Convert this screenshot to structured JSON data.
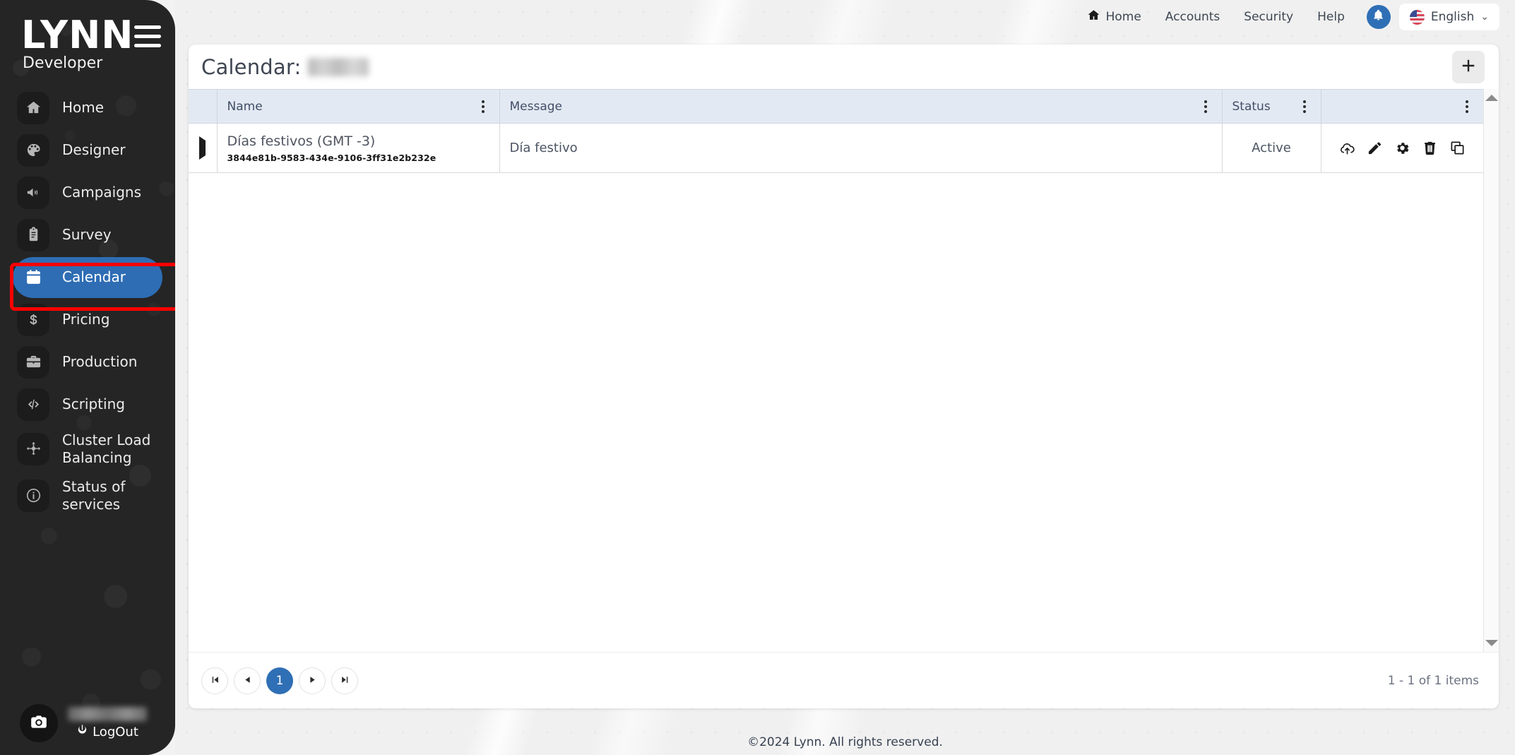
{
  "brand": {
    "logo": "LYNN",
    "subtitle": "Developer"
  },
  "sidebar": {
    "items": [
      {
        "label": "Home",
        "icon": "home-icon"
      },
      {
        "label": "Designer",
        "icon": "palette-icon"
      },
      {
        "label": "Campaigns",
        "icon": "megaphone-icon"
      },
      {
        "label": "Survey",
        "icon": "clipboard-icon"
      },
      {
        "label": "Calendar",
        "icon": "calendar-icon"
      },
      {
        "label": "Pricing",
        "icon": "dollar-icon"
      },
      {
        "label": "Production",
        "icon": "briefcase-icon"
      },
      {
        "label": "Scripting",
        "icon": "code-icon"
      },
      {
        "label": "Cluster Load Balancing",
        "icon": "cluster-icon"
      },
      {
        "label": "Status of services",
        "icon": "info-icon"
      }
    ],
    "active_item": "Calendar",
    "logout_label": "LogOut"
  },
  "topnav": {
    "links": [
      {
        "label": "Home",
        "icon": "home-icon"
      },
      {
        "label": "Accounts",
        "icon": ""
      },
      {
        "label": "Security",
        "icon": ""
      },
      {
        "label": "Help",
        "icon": ""
      }
    ],
    "notification_icon": "bell-icon",
    "language": "English",
    "language_chevron": "⌄"
  },
  "page": {
    "title_prefix": "Calendar:",
    "add_button_icon": "plus-icon"
  },
  "table": {
    "columns": [
      {
        "label": ""
      },
      {
        "label": "Name"
      },
      {
        "label": "Message"
      },
      {
        "label": "Status"
      },
      {
        "label": ""
      }
    ],
    "rows": [
      {
        "name": "Días festivos (GMT -3)",
        "uuid": "3844e81b-9583-434e-9106-3ff31e2b232e",
        "message": "Día festivo",
        "status": "Active",
        "actions": [
          "cloud-upload-icon",
          "edit-pencil-icon",
          "gear-icon",
          "trash-icon",
          "copy-icon"
        ]
      }
    ]
  },
  "pagination": {
    "first_label": "⏮",
    "prev_label": "◀",
    "current_page": "1",
    "next_label": "▶",
    "last_label": "⏭",
    "info": "1 - 1 of 1 items"
  },
  "footer": {
    "copyright": "©2024 Lynn. All rights reserved."
  },
  "colors": {
    "accent": "#2f6fb5",
    "sidebar_bg": "#252525",
    "highlight_box": "#ff0000"
  }
}
